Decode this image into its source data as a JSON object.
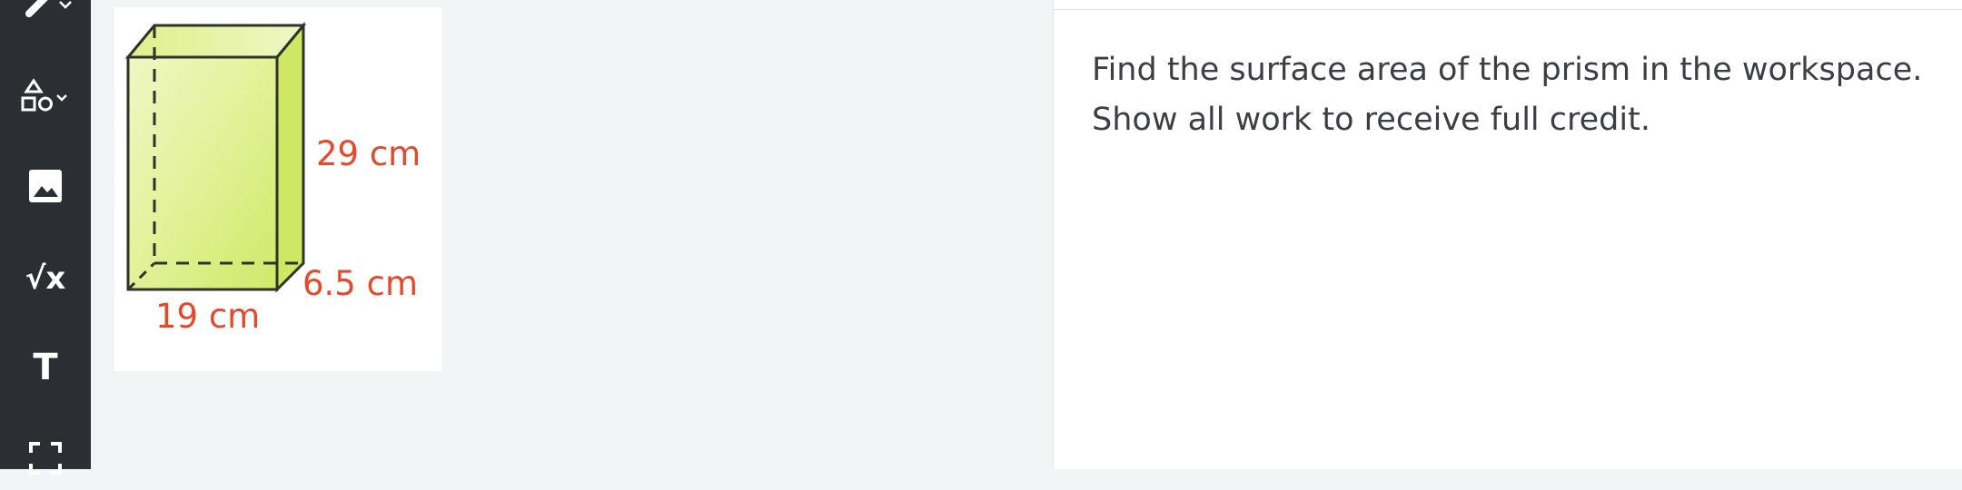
{
  "toolbar": {
    "tools": [
      {
        "name": "pen-tool",
        "icon": "pen-icon",
        "has_dropdown": true
      },
      {
        "name": "shapes-tool",
        "icon": "shapes-icon",
        "has_dropdown": true
      },
      {
        "name": "image-tool",
        "icon": "image-icon",
        "has_dropdown": false
      },
      {
        "name": "math-tool",
        "icon": "sqrt-x-icon",
        "has_dropdown": false
      },
      {
        "name": "text-tool",
        "icon": "text-t-icon",
        "has_dropdown": false
      },
      {
        "name": "select-tool",
        "icon": "dashed-select-icon",
        "has_dropdown": false
      }
    ],
    "math_symbol": "√x",
    "text_symbol": "T"
  },
  "figure": {
    "height_label": "29 cm",
    "depth_label": "6.5 cm",
    "width_label": "19 cm",
    "colors": {
      "prism_fill": "#d4ea67",
      "prism_light": "#eef7c4",
      "label": "#e5482a",
      "edge": "#2f3328"
    }
  },
  "question": {
    "line1": "Find the surface area of the prism in the workspace.",
    "line2": "Show all work to receive full credit."
  },
  "colors": {
    "toolbar_bg": "#2b2f33",
    "workspace_bg": "#f3f4f6",
    "panel_bg": "#ffffff",
    "text": "#3b3f45"
  }
}
